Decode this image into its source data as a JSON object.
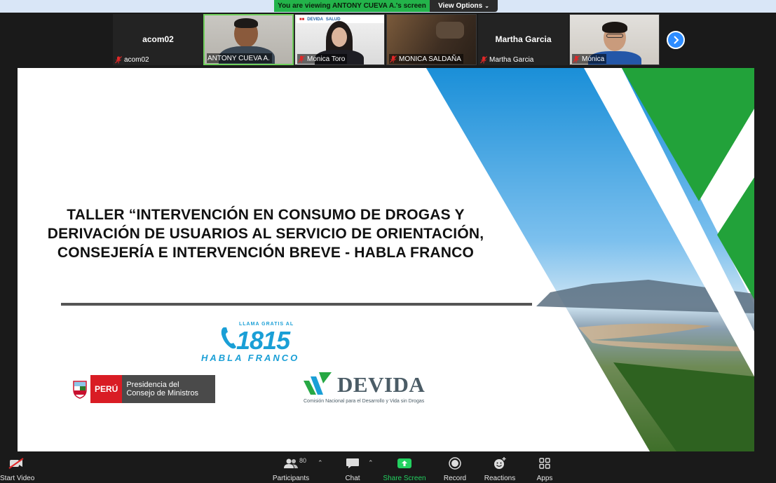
{
  "banner": {
    "viewing_text": "You are viewing ANTONY CUEVA A.'s screen",
    "view_options_label": "View Options"
  },
  "participants": [
    {
      "title": "acom02",
      "name": "acom02",
      "video": false
    },
    {
      "title": "",
      "name": "ANTONY CUEVA A.",
      "video": true
    },
    {
      "title": "",
      "name": "Monica Toro",
      "video": true
    },
    {
      "title": "",
      "name": "MONICA SALDAÑA",
      "video": true
    },
    {
      "title": "Martha Garcia",
      "name": "Martha Garcia",
      "video": false
    },
    {
      "title": "",
      "name": "Mónica",
      "video": true
    }
  ],
  "video_logos": {
    "devida": "DEVIDA",
    "salud": "SALUD"
  },
  "slide": {
    "title_lines": [
      "TALLER “INTERVENCIÓN EN CONSUMO DE DROGAS Y",
      "DERIVACIÓN DE USUARIOS AL SERVICIO DE ORIENTACIÓN,",
      "CONSEJERÍA E INTERVENCIÓN BREVE - HABLA FRANCO"
    ],
    "hotline": {
      "small": "LLAMA GRATIS AL",
      "number": "1815",
      "name": "HABLA FRANCO"
    },
    "peru": {
      "country": "PERÚ",
      "line1": "Presidencia del",
      "line2": "Consejo de Ministros"
    },
    "devida": {
      "name": "DEVIDA",
      "sub": "Comisión Nacional para el Desarrollo y Vida sin Drogas"
    }
  },
  "toolbar": {
    "start_video": "Start Video",
    "participants": "Participants",
    "participants_count": "80",
    "chat": "Chat",
    "share_screen": "Share Screen",
    "record": "Record",
    "reactions": "Reactions",
    "apps": "Apps"
  },
  "colors": {
    "share_green": "#23b34a",
    "zoom_blue": "#2d8cff",
    "slide_blue": "#1a9fd6",
    "slide_green": "#22a23a",
    "peru_red": "#d91c24"
  }
}
